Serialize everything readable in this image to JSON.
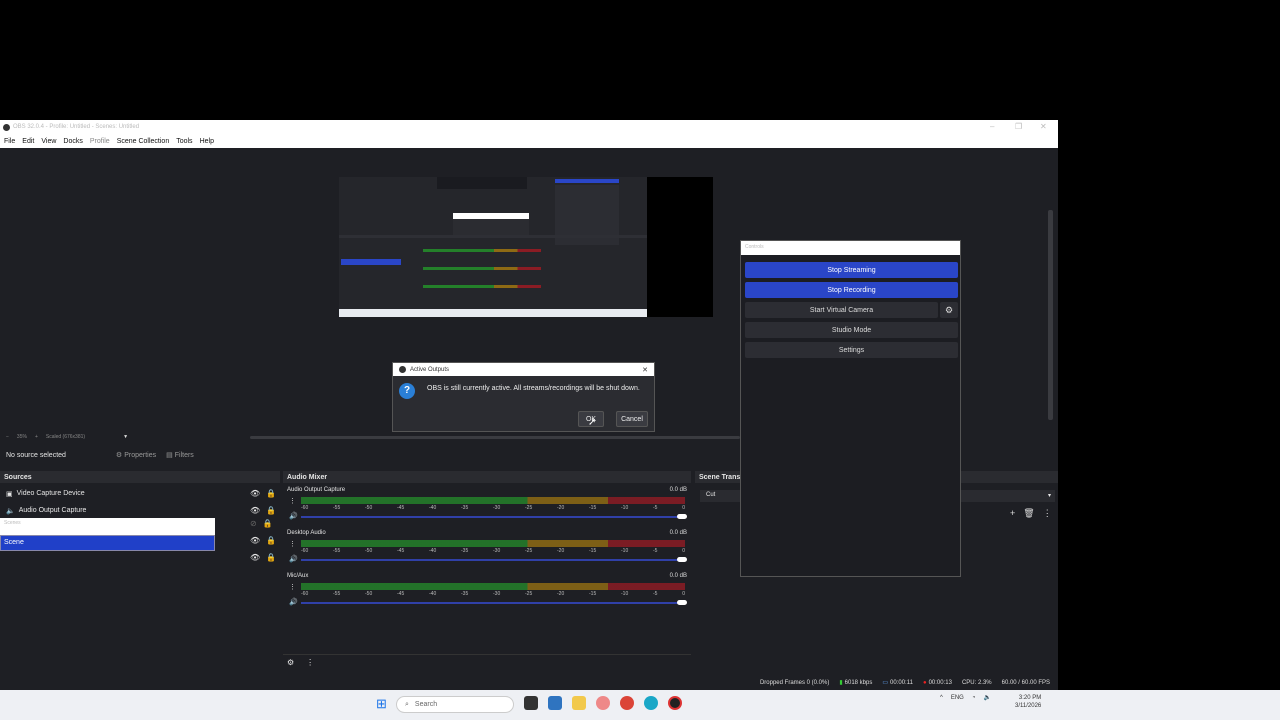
{
  "window": {
    "title": "OBS 32.0.4 - Profile: Untitled - Scenes: Untitled"
  },
  "menu": [
    "File",
    "Edit",
    "View",
    "Docks",
    "Profile",
    "Scene Collection",
    "Tools",
    "Help"
  ],
  "preview": {
    "zoom_label": "35%",
    "scale_label": "Scaled (676x381)"
  },
  "context_bar": {
    "selection": "No source selected",
    "properties": "Properties",
    "filters": "Filters"
  },
  "sources": {
    "title": "Sources",
    "items": [
      {
        "label": "Video Capture Device",
        "icon": "camera-icon"
      },
      {
        "label": "Audio Output Capture",
        "icon": "speaker-icon"
      }
    ]
  },
  "scenes": {
    "popup_label": "Scenes",
    "selected": "Scene"
  },
  "mixer": {
    "title": "Audio Mixer",
    "ticks": [
      "-60",
      "-55",
      "-50",
      "-45",
      "-40",
      "-35",
      "-30",
      "-25",
      "-20",
      "-15",
      "-10",
      "-5",
      "0"
    ],
    "channels": [
      {
        "name": "Audio Output Capture",
        "db": "0.0 dB"
      },
      {
        "name": "Desktop Audio",
        "db": "0.0 dB"
      },
      {
        "name": "Mic/Aux",
        "db": "0.0 dB"
      }
    ]
  },
  "transitions": {
    "title": "Scene Trans",
    "selected": "Cut"
  },
  "controls": {
    "title": "Controls",
    "stop_streaming": "Stop Streaming",
    "stop_recording": "Stop Recording",
    "start_virtual_camera": "Start Virtual Camera",
    "studio_mode": "Studio Mode",
    "settings": "Settings"
  },
  "dialog": {
    "title": "Active Outputs",
    "message": "OBS is still currently active. All streams/recordings will be shut down.",
    "ok": "OK",
    "cancel": "Cancel"
  },
  "status": {
    "dropped": "Dropped Frames 0 (0.0%)",
    "bitrate": "6018 kbps",
    "stream_time": "00:00:11",
    "rec_time": "00:00:13",
    "cpu": "CPU: 2.3%",
    "fps": "60.00 / 60.00 FPS"
  },
  "taskbar": {
    "search": "Search",
    "lang": "ENG",
    "time": "3:20 PM",
    "date": "3/11/2026"
  },
  "colors": {
    "accent": "#2a46c8",
    "meter_green": "#24802a",
    "meter_yellow": "#8e6a14",
    "meter_red": "#8b1c24"
  }
}
